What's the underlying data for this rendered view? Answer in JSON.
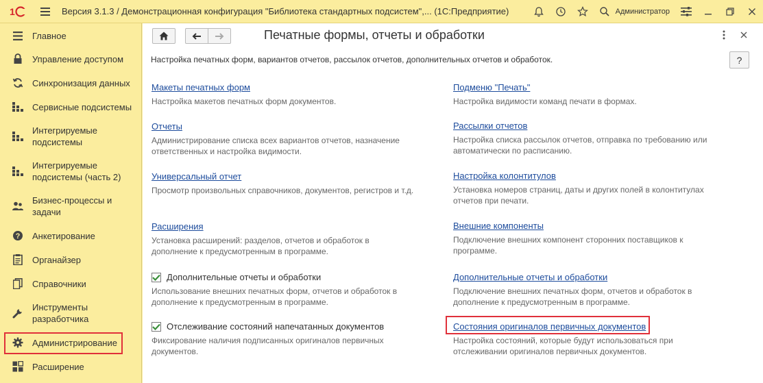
{
  "window": {
    "title": "Версия 3.1.3 / Демонстрационная конфигурация \"Библиотека стандартных подсистем\",... (1С:Предприятие)",
    "user": "Администратор",
    "logo": "1С",
    "icons": [
      "bell-icon",
      "history-icon",
      "star-icon",
      "search-icon",
      "settings-icon",
      "minimize-icon",
      "restore-icon",
      "close-icon"
    ]
  },
  "sidebar": {
    "items": [
      {
        "label": "Главное",
        "icon": "list-icon"
      },
      {
        "label": "Управление доступом",
        "icon": "lock-icon"
      },
      {
        "label": "Синхронизация данных",
        "icon": "sync-icon"
      },
      {
        "label": "Сервисные подсистемы",
        "icon": "grid-icon"
      },
      {
        "label": "Интегрируемые\nподсистемы",
        "icon": "grid-icon"
      },
      {
        "label": "Интегрируемые\nподсистемы (часть 2)",
        "icon": "grid-icon"
      },
      {
        "label": "Бизнес-процессы и\nзадачи",
        "icon": "people-icon"
      },
      {
        "label": "Анкетирование",
        "icon": "question-icon"
      },
      {
        "label": "Органайзер",
        "icon": "notepad-icon"
      },
      {
        "label": "Справочники",
        "icon": "books-icon"
      },
      {
        "label": "Инструменты\nразработчика",
        "icon": "wrench-icon"
      },
      {
        "label": "Администрирование",
        "icon": "gear-icon"
      },
      {
        "label": "Расширение",
        "icon": "blocks-icon"
      }
    ],
    "selected": "Администрирование"
  },
  "main": {
    "title": "Печатные формы, отчеты и обработки",
    "description": "Настройка печатных форм, вариантов отчетов, рассылок отчетов, дополнительных отчетов и обработок.",
    "help": "?",
    "left": [
      {
        "type": "link",
        "label": "Макеты печатных форм",
        "text": "Настройка макетов печатных форм документов."
      },
      {
        "type": "link",
        "label": "Отчеты",
        "text": "Администрирование списка всех вариантов отчетов, назначение\nответственных и настройка видимости."
      },
      {
        "type": "link",
        "label": "Универсальный отчет",
        "text": "Просмотр произвольных справочников, документов, регистров и т.д."
      },
      {
        "type": "link",
        "label": "Расширения",
        "text": "Установка расширений: разделов, отчетов и обработок в\nдополнение к предусмотренным в программе."
      },
      {
        "type": "checkbox",
        "checked": true,
        "label": "Дополнительные отчеты и обработки",
        "text": "Использование внешних печатных форм, отчетов и обработок в\nдополнение к предусмотренным в программе."
      },
      {
        "type": "checkbox",
        "checked": true,
        "label": "Отслеживание состояний напечатанных документов",
        "text": "Фиксирование наличия подписанных оригиналов первичных\nдокументов."
      }
    ],
    "right": [
      {
        "type": "link",
        "label": "Подменю \"Печать\"",
        "text": "Настройка видимости команд печати в формах."
      },
      {
        "type": "link",
        "label": "Рассылки отчетов",
        "text": "Настройка списка рассылок отчетов, отправка по требованию или\nавтоматически по расписанию."
      },
      {
        "type": "link",
        "label": "Настройка колонтитулов",
        "text": "Установка номеров страниц, даты и других полей в колонтитулах\nотчетов при печати."
      },
      {
        "type": "link",
        "label": "Внешние компоненты",
        "text": "Подключение внешних компонент сторонних поставщиков к\nпрограмме."
      },
      {
        "type": "link",
        "label": "Дополнительные отчеты и обработки",
        "text": "Подключение внешних печатных форм, отчетов и обработок в\nдополнение к предусмотренным в программе."
      },
      {
        "type": "link",
        "label": "Состояния оригиналов первичных документов",
        "text": "Настройка состояний, которые будут использоваться при\nотслеживании оригиналов первичных документов."
      }
    ]
  },
  "colors": {
    "panel": "#fbed9e",
    "link": "#1c4b9c",
    "highlight": "#e0303a",
    "check": "#3a8f3a"
  }
}
